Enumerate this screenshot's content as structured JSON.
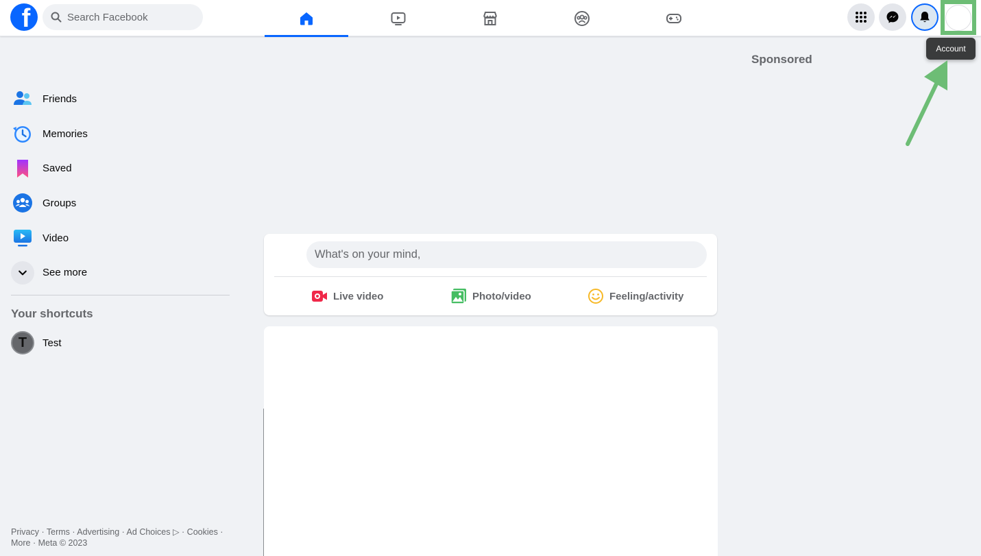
{
  "header": {
    "search_placeholder": "Search Facebook",
    "logo_letter": "f",
    "nav_tabs": [
      "home",
      "watch",
      "marketplace",
      "groups",
      "gaming"
    ],
    "active_tab": "home",
    "account_tooltip": "Account"
  },
  "sidebar": {
    "items": [
      {
        "label": "Friends",
        "icon": "friends-icon"
      },
      {
        "label": "Memories",
        "icon": "memories-icon"
      },
      {
        "label": "Saved",
        "icon": "saved-icon"
      },
      {
        "label": "Groups",
        "icon": "groups-icon"
      },
      {
        "label": "Video",
        "icon": "video-icon"
      },
      {
        "label": "See more",
        "icon": "chevron-down-icon"
      }
    ],
    "shortcuts_title": "Your shortcuts",
    "shortcuts": [
      {
        "label": "Test",
        "initial": "T"
      }
    ],
    "footer": "Privacy · Terms · Advertising · Ad Choices ▷ · Cookies · More · Meta © 2023"
  },
  "composer": {
    "placeholder": "What's on your mind,",
    "actions": [
      {
        "label": "Live video",
        "icon": "live-video-icon",
        "color": "#f02849"
      },
      {
        "label": "Photo/video",
        "icon": "photo-video-icon",
        "color": "#45bd62"
      },
      {
        "label": "Feeling/activity",
        "icon": "feeling-icon",
        "color": "#f7b928"
      }
    ]
  },
  "right_rail": {
    "sponsored_title": "Sponsored"
  },
  "colors": {
    "brand": "#0866ff",
    "highlight": "#6dbd75"
  }
}
